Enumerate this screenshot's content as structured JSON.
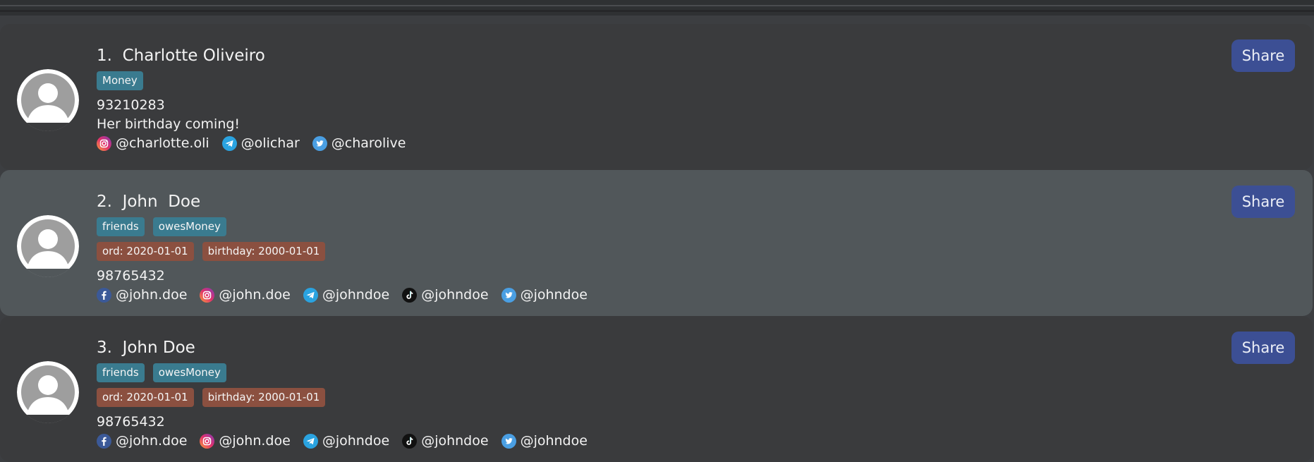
{
  "share_label": "Share",
  "colors": {
    "background": "#3c3e41",
    "card": "#3a3b3d",
    "card_selected": "#51575a",
    "tag_chip": "#3a7b8f",
    "date_chip": "#8b5040",
    "share_button": "#3c4f94"
  },
  "persons": [
    {
      "index": "1.",
      "name": "Charlotte Oliveiro",
      "selected": false,
      "tags": [
        "Money"
      ],
      "dates": [],
      "phone": "93210283",
      "remark": "Her birthday coming!",
      "socials": [
        {
          "icon": "instagram-icon",
          "handle": "@charlotte.oli"
        },
        {
          "icon": "telegram-icon",
          "handle": "@olichar"
        },
        {
          "icon": "twitter-icon",
          "handle": "@charolive"
        }
      ]
    },
    {
      "index": "2.",
      "name": "John  Doe",
      "selected": true,
      "tags": [
        "friends",
        "owesMoney"
      ],
      "dates": [
        "ord: 2020-01-01",
        "birthday: 2000-01-01"
      ],
      "phone": "98765432",
      "remark": "",
      "socials": [
        {
          "icon": "facebook-icon",
          "handle": "@john.doe"
        },
        {
          "icon": "instagram-icon",
          "handle": "@john.doe"
        },
        {
          "icon": "telegram-icon",
          "handle": "@johndoe"
        },
        {
          "icon": "tiktok-icon",
          "handle": "@johndoe"
        },
        {
          "icon": "twitter-icon",
          "handle": "@johndoe"
        }
      ]
    },
    {
      "index": "3.",
      "name": "John Doe",
      "selected": false,
      "tags": [
        "friends",
        "owesMoney"
      ],
      "dates": [
        "ord: 2020-01-01",
        "birthday: 2000-01-01"
      ],
      "phone": "98765432",
      "remark": "",
      "socials": [
        {
          "icon": "facebook-icon",
          "handle": "@john.doe"
        },
        {
          "icon": "instagram-icon",
          "handle": "@john.doe"
        },
        {
          "icon": "telegram-icon",
          "handle": "@johndoe"
        },
        {
          "icon": "tiktok-icon",
          "handle": "@johndoe"
        },
        {
          "icon": "twitter-icon",
          "handle": "@johndoe"
        }
      ]
    }
  ]
}
